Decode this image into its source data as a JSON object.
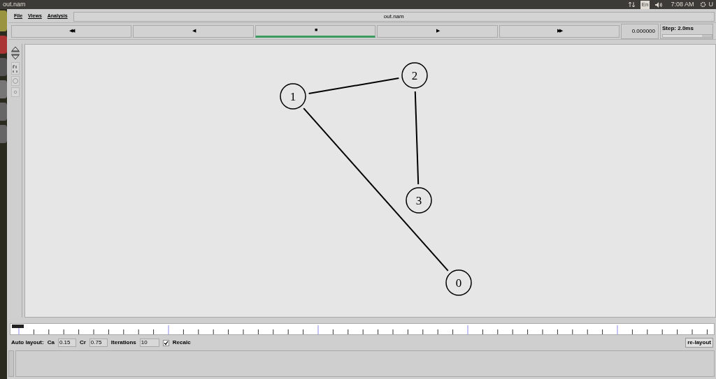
{
  "top_bar": {
    "title": "out.nam",
    "keyboard": "En",
    "clock": "7:08 AM",
    "user": "U"
  },
  "menu": [
    "File",
    "Views",
    "Analysis"
  ],
  "file_field": "out.nam",
  "controls": [
    {
      "label": "◀◀",
      "selected": false
    },
    {
      "label": "◀",
      "selected": false
    },
    {
      "label": "■",
      "selected": true
    },
    {
      "label": "▶",
      "selected": false
    },
    {
      "label": "▶▶",
      "selected": false
    }
  ],
  "time": "0.000000",
  "step": {
    "label": "Step: 2.0ms",
    "level": 0.8
  },
  "network": {
    "nodes": [
      "1",
      "2",
      "3",
      "0"
    ]
  },
  "auto_layout": {
    "label": "Auto layout:",
    "ca_label": "Ca",
    "ca": "0.15",
    "cr_label": "Cr",
    "cr": "0.75",
    "iterations_label": "Iterations",
    "iterations": "10",
    "recalc": {
      "label": "Recalc",
      "checked": true
    },
    "button": "re-layout"
  }
}
